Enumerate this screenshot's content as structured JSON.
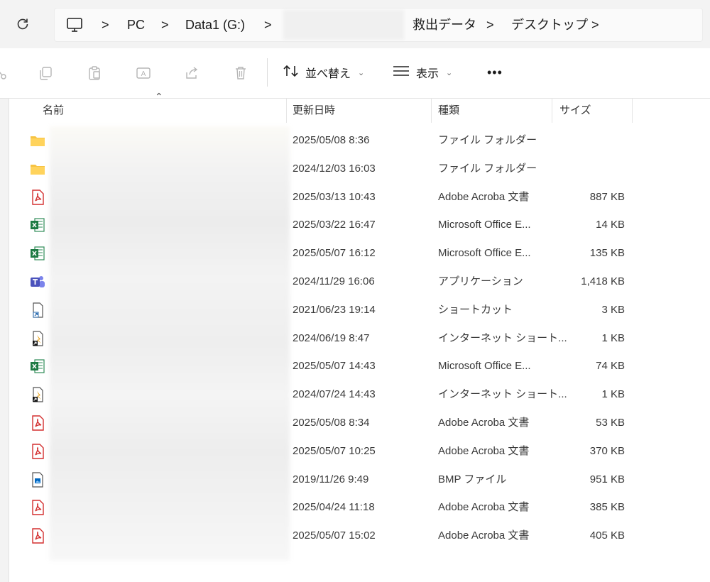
{
  "address": {
    "crumbs": [
      "PC",
      "Data1 (G:)",
      "救出データ",
      "デスクトップ"
    ],
    "separator": ">"
  },
  "commandbar": {
    "sort_label": "並べ替え",
    "view_label": "表示",
    "more_label": "•••",
    "chevron": "⌄"
  },
  "columns": {
    "name": "名前",
    "modified": "更新日時",
    "type": "種類",
    "size": "サイズ"
  },
  "files": [
    {
      "icon": "folder-icon",
      "modified": "2025/05/08 8:36",
      "type": "ファイル フォルダー",
      "size": ""
    },
    {
      "icon": "folder-icon",
      "modified": "2024/12/03 16:03",
      "type": "ファイル フォルダー",
      "size": ""
    },
    {
      "icon": "pdf-icon",
      "modified": "2025/03/13 10:43",
      "type": "Adobe Acroba 文書",
      "size": "887 KB"
    },
    {
      "icon": "excel-icon",
      "modified": "2025/03/22 16:47",
      "type": "Microsoft Office E...",
      "size": "14 KB"
    },
    {
      "icon": "excel-icon",
      "modified": "2025/05/07 16:12",
      "type": "Microsoft Office E...",
      "size": "135 KB"
    },
    {
      "icon": "teams-icon",
      "modified": "2024/11/29 16:06",
      "type": "アプリケーション",
      "size": "1,418 KB"
    },
    {
      "icon": "shortcut-icon",
      "modified": "2021/06/23 19:14",
      "type": "ショートカット",
      "size": "3 KB"
    },
    {
      "icon": "internet-shortcut-icon",
      "modified": "2024/06/19 8:47",
      "type": "インターネット ショート...",
      "size": "1 KB"
    },
    {
      "icon": "excel-icon",
      "modified": "2025/05/07 14:43",
      "type": "Microsoft Office E...",
      "size": "74 KB"
    },
    {
      "icon": "internet-shortcut-icon",
      "modified": "2024/07/24 14:43",
      "type": "インターネット ショート...",
      "size": "1 KB"
    },
    {
      "icon": "pdf-icon",
      "modified": "2025/05/08 8:34",
      "type": "Adobe Acroba 文書",
      "size": "53 KB"
    },
    {
      "icon": "pdf-icon",
      "modified": "2025/05/07 10:25",
      "type": "Adobe Acroba 文書",
      "size": "370 KB"
    },
    {
      "icon": "bmp-icon",
      "modified": "2019/11/26 9:49",
      "type": "BMP ファイル",
      "size": "951 KB"
    },
    {
      "icon": "pdf-icon",
      "modified": "2025/04/24 11:18",
      "type": "Adobe Acroba 文書",
      "size": "385 KB"
    },
    {
      "icon": "pdf-icon",
      "modified": "2025/05/07 15:02",
      "type": "Adobe Acroba 文書",
      "size": "405 KB"
    }
  ],
  "colors": {
    "folder": "#f6c343",
    "pdf": "#d32f2f",
    "excel": "#1d7a43",
    "teams": "#4b53bc",
    "accent": "#0067c0"
  }
}
